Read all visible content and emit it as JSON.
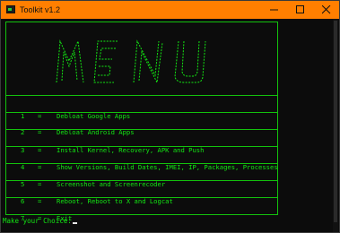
{
  "window": {
    "title": "Toolkit v1.2"
  },
  "menu": [
    {
      "num": "1",
      "sep": "=",
      "label": "Debloat Google Apps"
    },
    {
      "num": "2",
      "sep": "=",
      "label": "Debloat Android Apps"
    },
    {
      "num": "3",
      "sep": "=",
      "label": "Install Kernel, Recovery, APK and Push"
    },
    {
      "num": "4",
      "sep": "=",
      "label": "Show Versions, Build Dates, IMEI, IP, Packages, Processes"
    },
    {
      "num": "5",
      "sep": "=",
      "label": "Screenshot and Screenrecoder"
    },
    {
      "num": "6",
      "sep": "=",
      "label": "Reboot, Reboot to X and Logcat"
    },
    {
      "num": "7",
      "sep": "=",
      "label": "Exit"
    }
  ],
  "prompt": {
    "text": "Make your Choice:"
  },
  "colors": {
    "titlebar": "#ff7f00",
    "console_text": "#13e613",
    "background": "#0c0c0c"
  },
  "icons": {
    "minimize": "minimize-icon",
    "maximize": "maximize-icon",
    "close": "close-icon"
  }
}
